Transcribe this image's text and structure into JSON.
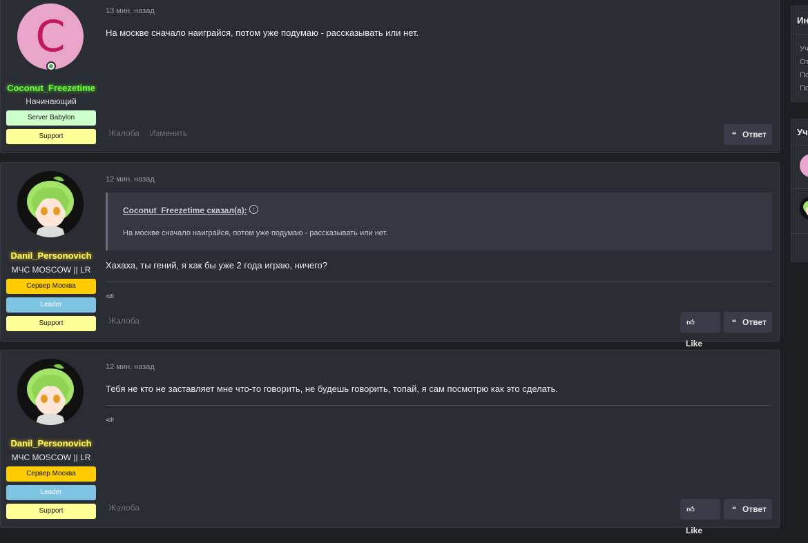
{
  "posts": [
    {
      "time": "13 мин. назад",
      "text": "На москве сначало наиграйся, потом уже подумаю - рассказывать или нет.",
      "username": "Coconut_Freezetime",
      "user_title": "Начинающий",
      "avatar_letter": "C",
      "badges": [
        "Server Babylon",
        "Support"
      ],
      "actions": [
        "Жалоба",
        "Изменить"
      ],
      "buttons": [
        "Ответ"
      ]
    },
    {
      "time": "12 мин. назад",
      "quote_author": "Coconut_Freezetime сказал(а):",
      "quote_text": "На москве сначало наиграйся, потом уже подумаю - рассказывать или нет.",
      "text": "Хахаха, ты гений, я как бы уже 2 года играю, ничего?",
      "signature": "ﷲ",
      "username": "Danil_Personovich",
      "user_title": "МЧС MOSCOW || LR",
      "badges": [
        "Сервер Москва",
        "Leader",
        "Support"
      ],
      "actions": [
        "Жалоба"
      ],
      "buttons": [
        "Like",
        "Ответ"
      ]
    },
    {
      "time": "12 мин. назад",
      "text": "Тебя не кто не заставляет мне что-то говорить, не будешь говорить, топай, я сам посмотрю как это сделать.",
      "signature": "ﷲ",
      "username": "Danil_Personovich",
      "user_title": "МЧС MOSCOW || LR",
      "badges": [
        "Сервер Москва",
        "Leader",
        "Support"
      ],
      "actions": [
        "Жалоба"
      ],
      "buttons": [
        "Like",
        "Ответ"
      ]
    }
  ],
  "sidebar": {
    "block1_title": "Ин",
    "block1_lines": [
      "Уч",
      "От",
      "По",
      "По"
    ],
    "block2_title": "Уч"
  },
  "icons": {
    "reply": "quote-icon",
    "like": "thumbs-up-icon",
    "online": "online-status-icon",
    "quote_jump": "arrow-up-circle-icon"
  },
  "colors": {
    "background": "#1e1f23",
    "post_background": "#2b2d35",
    "username_green": "#66ff33",
    "username_yellow": "#ffff66"
  }
}
